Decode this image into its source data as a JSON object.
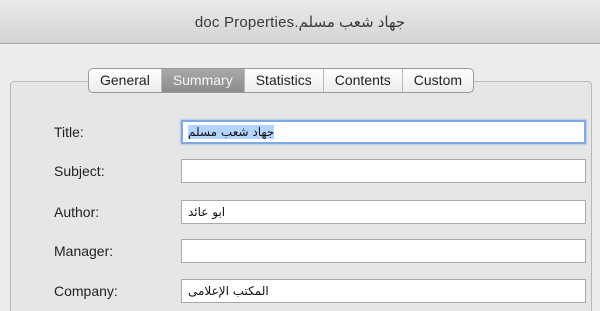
{
  "window": {
    "title": "جهاد شعب مسلم.doc Properties"
  },
  "tabs": [
    {
      "label": "General",
      "active": false
    },
    {
      "label": "Summary",
      "active": true
    },
    {
      "label": "Statistics",
      "active": false
    },
    {
      "label": "Contents",
      "active": false
    },
    {
      "label": "Custom",
      "active": false
    }
  ],
  "fields": {
    "title": {
      "label": "Title:",
      "value": "جهاد شعب مسلم"
    },
    "subject": {
      "label": "Subject:",
      "value": ""
    },
    "author": {
      "label": "Author:",
      "value": "ابو عائد"
    },
    "manager": {
      "label": "Manager:",
      "value": ""
    },
    "company": {
      "label": "Company:",
      "value": "المكتب الإعلامى"
    }
  },
  "colors": {
    "selection": "#b5d4fd",
    "focus_ring": "#7fa9e3",
    "active_tab": "#9a9a9a"
  }
}
